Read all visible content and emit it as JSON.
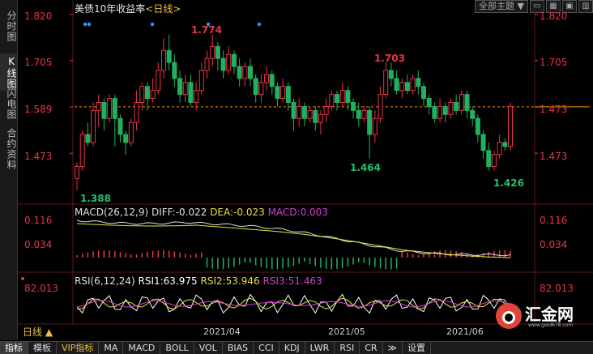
{
  "left_tabs": [
    {
      "label": "分时图",
      "active": false
    },
    {
      "label": "K线图",
      "active": true
    },
    {
      "label": "闪电图",
      "active": false
    },
    {
      "label": "合约资料",
      "active": false
    }
  ],
  "chart_title": "美债10年收益率",
  "chart_period": "<日线>",
  "toolbar": {
    "theme_label": "全部主题",
    "theme_arrow": "▼"
  },
  "price_axis": {
    "ticks": [
      "1.820",
      "1.705",
      "1.589",
      "1.473"
    ],
    "current": "1.589"
  },
  "annotations": {
    "high1": "1.774",
    "high2": "1.703",
    "low1": "1.388",
    "low2": "1.464",
    "low3": "1.426"
  },
  "macd": {
    "label": "MACD(26,12,9)",
    "diff": "DIFF:-0.022",
    "dea": "DEA:-0.023",
    "macd": "MACD:0.003",
    "ticks": [
      "0.116",
      "0.034"
    ]
  },
  "rsi": {
    "label": "RSI(6,12,24)",
    "rsi1": "RSI1:63.975",
    "rsi2": "RSI2:53.946",
    "rsi3": "RSI3:51.463",
    "tick": "82.013"
  },
  "period_tab": "日线 ▲",
  "dates": [
    "2021/04",
    "2021/05",
    "2021/06"
  ],
  "bottom_tabs": [
    {
      "label": "指标",
      "active": true
    },
    {
      "label": "模板"
    },
    {
      "label": "VIP指标",
      "vip": true
    },
    {
      "label": "MA"
    },
    {
      "label": "MACD"
    },
    {
      "label": "BOLL"
    },
    {
      "label": "VOL"
    },
    {
      "label": "BIAS"
    },
    {
      "label": "CCI"
    },
    {
      "label": "KDJ"
    },
    {
      "label": "LWR"
    },
    {
      "label": "RSI"
    },
    {
      "label": "CR"
    },
    {
      "label": "≫"
    },
    {
      "label": "设置"
    }
  ],
  "logo": {
    "text": "汇金网",
    "url": "www.gold678.com"
  },
  "colors": {
    "up": "#e8344a",
    "down": "#20b060",
    "diff": "#e0e0e0",
    "dea": "#e8e040",
    "rsi1": "#ffffff",
    "rsi2": "#e8e040",
    "rsi3": "#d040d0",
    "current_line": "#ff8c00"
  },
  "chart_data": {
    "type": "candlestick",
    "ylim": [
      1.36,
      1.84
    ],
    "candles": [
      [
        1.41,
        1.44,
        1.38,
        1.45
      ],
      [
        1.44,
        1.52,
        1.43,
        1.53
      ],
      [
        1.52,
        1.5,
        1.49,
        1.55
      ],
      [
        1.5,
        1.58,
        1.49,
        1.6
      ],
      [
        1.58,
        1.6,
        1.54,
        1.62
      ],
      [
        1.6,
        1.56,
        1.53,
        1.61
      ],
      [
        1.56,
        1.61,
        1.55,
        1.62
      ],
      [
        1.61,
        1.56,
        1.49,
        1.62
      ],
      [
        1.56,
        1.52,
        1.5,
        1.57
      ],
      [
        1.52,
        1.5,
        1.47,
        1.53
      ],
      [
        1.5,
        1.55,
        1.49,
        1.56
      ],
      [
        1.55,
        1.6,
        1.53,
        1.63
      ],
      [
        1.6,
        1.64,
        1.58,
        1.65
      ],
      [
        1.64,
        1.61,
        1.58,
        1.65
      ],
      [
        1.61,
        1.63,
        1.6,
        1.66
      ],
      [
        1.63,
        1.68,
        1.62,
        1.7
      ],
      [
        1.68,
        1.73,
        1.66,
        1.76
      ],
      [
        1.73,
        1.7,
        1.68,
        1.77
      ],
      [
        1.7,
        1.66,
        1.64,
        1.72
      ],
      [
        1.66,
        1.62,
        1.6,
        1.68
      ],
      [
        1.62,
        1.65,
        1.6,
        1.67
      ],
      [
        1.65,
        1.6,
        1.59,
        1.67
      ],
      [
        1.6,
        1.63,
        1.58,
        1.65
      ],
      [
        1.63,
        1.68,
        1.62,
        1.7
      ],
      [
        1.68,
        1.71,
        1.66,
        1.73
      ],
      [
        1.71,
        1.74,
        1.69,
        1.77
      ],
      [
        1.74,
        1.71,
        1.68,
        1.75
      ],
      [
        1.71,
        1.68,
        1.66,
        1.73
      ],
      [
        1.68,
        1.72,
        1.67,
        1.74
      ],
      [
        1.72,
        1.69,
        1.67,
        1.73
      ],
      [
        1.69,
        1.66,
        1.64,
        1.71
      ],
      [
        1.66,
        1.69,
        1.64,
        1.7
      ],
      [
        1.69,
        1.66,
        1.64,
        1.71
      ],
      [
        1.66,
        1.62,
        1.6,
        1.67
      ],
      [
        1.62,
        1.65,
        1.6,
        1.67
      ],
      [
        1.65,
        1.67,
        1.63,
        1.69
      ],
      [
        1.67,
        1.64,
        1.62,
        1.68
      ],
      [
        1.64,
        1.61,
        1.59,
        1.65
      ],
      [
        1.61,
        1.64,
        1.6,
        1.66
      ],
      [
        1.64,
        1.6,
        1.58,
        1.65
      ],
      [
        1.6,
        1.56,
        1.53,
        1.61
      ],
      [
        1.56,
        1.59,
        1.54,
        1.61
      ],
      [
        1.59,
        1.56,
        1.54,
        1.6
      ],
      [
        1.56,
        1.58,
        1.55,
        1.59
      ],
      [
        1.58,
        1.55,
        1.53,
        1.59
      ],
      [
        1.55,
        1.57,
        1.52,
        1.58
      ],
      [
        1.57,
        1.59,
        1.55,
        1.61
      ],
      [
        1.59,
        1.62,
        1.58,
        1.63
      ],
      [
        1.62,
        1.6,
        1.58,
        1.63
      ],
      [
        1.6,
        1.63,
        1.59,
        1.65
      ],
      [
        1.63,
        1.6,
        1.58,
        1.64
      ],
      [
        1.6,
        1.58,
        1.56,
        1.61
      ],
      [
        1.58,
        1.56,
        1.54,
        1.6
      ],
      [
        1.56,
        1.58,
        1.55,
        1.59
      ],
      [
        1.58,
        1.52,
        1.46,
        1.59
      ],
      [
        1.52,
        1.56,
        1.5,
        1.58
      ],
      [
        1.56,
        1.62,
        1.55,
        1.64
      ],
      [
        1.62,
        1.68,
        1.61,
        1.7
      ],
      [
        1.68,
        1.66,
        1.64,
        1.7
      ],
      [
        1.66,
        1.63,
        1.62,
        1.68
      ],
      [
        1.63,
        1.65,
        1.61,
        1.66
      ],
      [
        1.65,
        1.63,
        1.62,
        1.67
      ],
      [
        1.63,
        1.66,
        1.62,
        1.67
      ],
      [
        1.66,
        1.64,
        1.62,
        1.68
      ],
      [
        1.64,
        1.61,
        1.59,
        1.65
      ],
      [
        1.61,
        1.59,
        1.57,
        1.62
      ],
      [
        1.59,
        1.56,
        1.55,
        1.6
      ],
      [
        1.56,
        1.59,
        1.55,
        1.61
      ],
      [
        1.59,
        1.57,
        1.55,
        1.6
      ],
      [
        1.57,
        1.6,
        1.56,
        1.61
      ],
      [
        1.6,
        1.58,
        1.57,
        1.62
      ],
      [
        1.58,
        1.62,
        1.57,
        1.63
      ],
      [
        1.62,
        1.58,
        1.56,
        1.63
      ],
      [
        1.58,
        1.56,
        1.54,
        1.59
      ],
      [
        1.56,
        1.52,
        1.5,
        1.57
      ],
      [
        1.52,
        1.48,
        1.46,
        1.53
      ],
      [
        1.48,
        1.44,
        1.43,
        1.5
      ],
      [
        1.44,
        1.47,
        1.43,
        1.48
      ],
      [
        1.47,
        1.5,
        1.46,
        1.52
      ],
      [
        1.5,
        1.49,
        1.48,
        1.51
      ],
      [
        1.49,
        1.59,
        1.48,
        1.6
      ]
    ]
  }
}
